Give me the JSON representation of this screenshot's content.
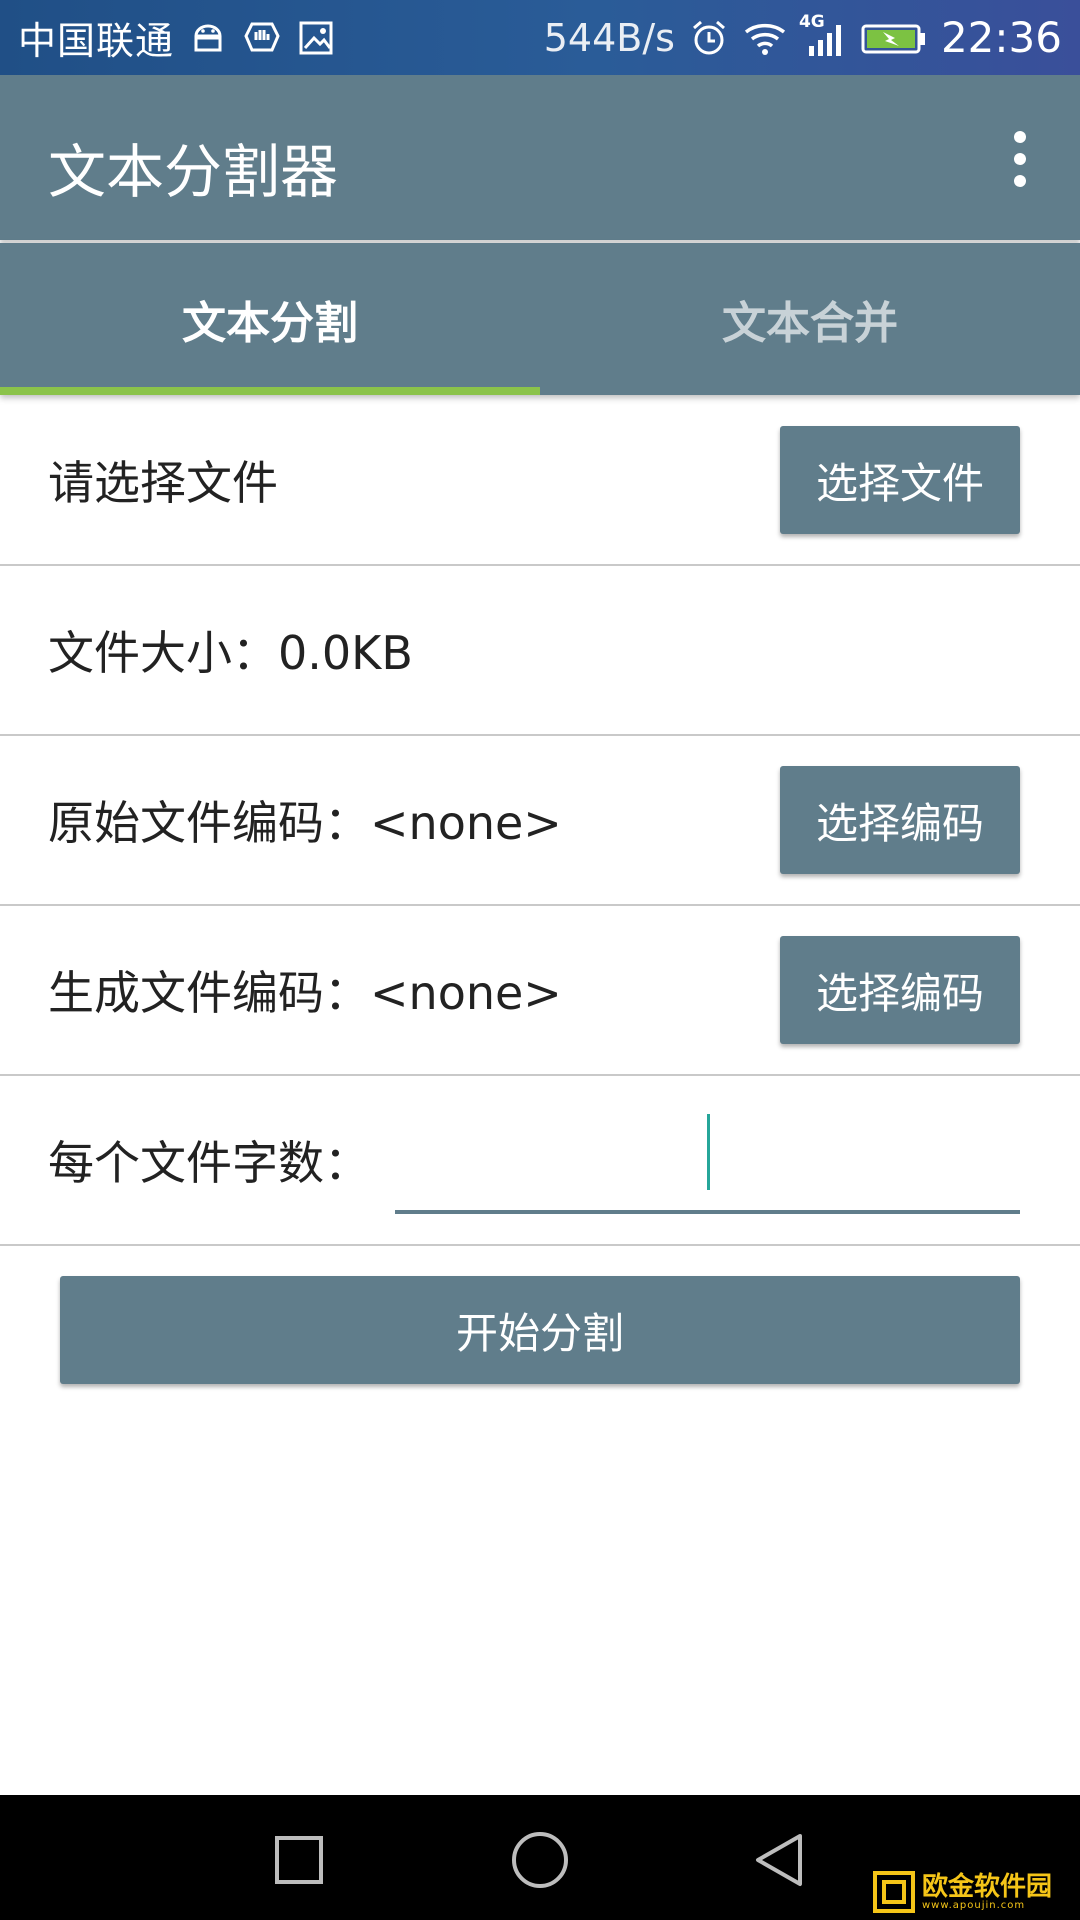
{
  "status_bar": {
    "carrier": "中国联通",
    "speed": "544B/s",
    "network": "4G",
    "time": "22:36",
    "icons": [
      "android-icon",
      "shield-icon",
      "image-icon",
      "alarm-icon",
      "wifi-icon",
      "signal-icon",
      "battery-charging-icon"
    ]
  },
  "app_bar": {
    "title": "文本分割器",
    "menu_icon": "more-vert-icon"
  },
  "tabs": [
    {
      "label": "文本分割",
      "active": true
    },
    {
      "label": "文本合并",
      "active": false
    }
  ],
  "rows": {
    "select_file": {
      "label": "请选择文件",
      "button": "选择文件"
    },
    "file_size": {
      "label": "文件大小：0.0KB"
    },
    "source_encoding": {
      "label": "原始文件编码：<none>",
      "button": "选择编码"
    },
    "target_encoding": {
      "label": "生成文件编码：<none>",
      "button": "选择编码"
    },
    "chars_per_file": {
      "label": "每个文件字数：",
      "value": ""
    }
  },
  "start_button": "开始分割",
  "nav_bar": {
    "icons": [
      "recent-apps-icon",
      "home-icon",
      "back-icon"
    ]
  },
  "watermark": {
    "text": "欧金软件园",
    "url": "www.apoujin.com"
  },
  "colors": {
    "primary": "#607d8b",
    "tab_indicator": "#8bc34a",
    "cursor": "#26a69a"
  }
}
